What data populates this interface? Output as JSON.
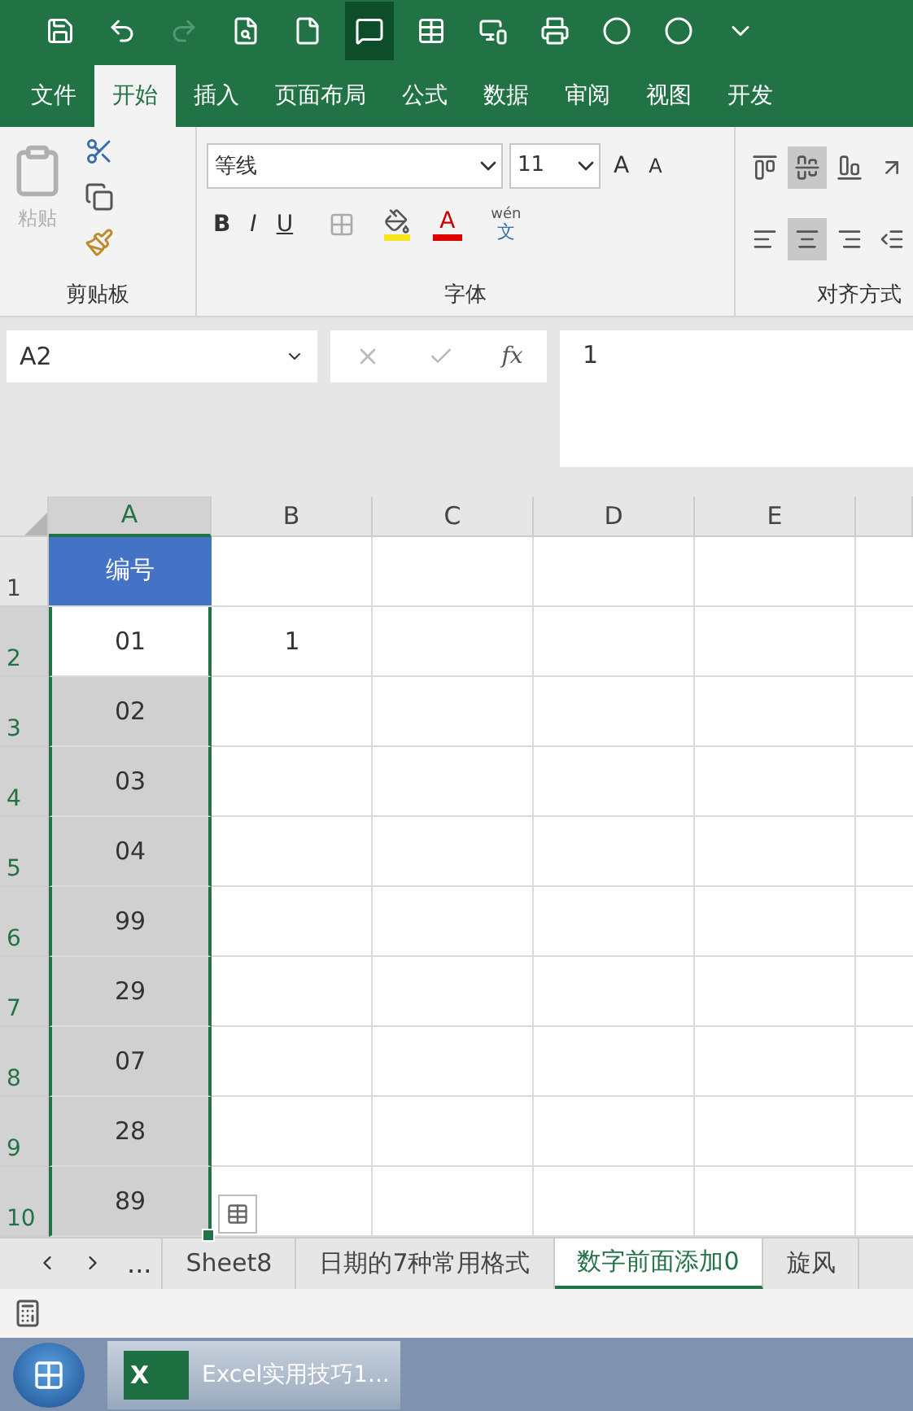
{
  "quick_access": [
    {
      "kind": "save",
      "highlighted": false,
      "disabled": false
    },
    {
      "kind": "undo",
      "highlighted": false,
      "disabled": false
    },
    {
      "kind": "redo",
      "highlighted": false,
      "disabled": true
    },
    {
      "kind": "preview",
      "highlighted": false,
      "disabled": false
    },
    {
      "kind": "new",
      "highlighted": false,
      "disabled": false
    },
    {
      "kind": "comment",
      "highlighted": true,
      "disabled": false
    },
    {
      "kind": "table",
      "highlighted": false,
      "disabled": false
    },
    {
      "kind": "device",
      "highlighted": false,
      "disabled": false
    },
    {
      "kind": "printer",
      "highlighted": false,
      "disabled": false
    },
    {
      "kind": "circle",
      "highlighted": false,
      "disabled": false
    },
    {
      "kind": "circle",
      "highlighted": false,
      "disabled": false
    },
    {
      "kind": "customize",
      "highlighted": false,
      "disabled": false
    }
  ],
  "ribbon_tabs": [
    {
      "label": "文件",
      "selected": false
    },
    {
      "label": "开始",
      "selected": true
    },
    {
      "label": "插入",
      "selected": false
    },
    {
      "label": "页面布局",
      "selected": false
    },
    {
      "label": "公式",
      "selected": false
    },
    {
      "label": "数据",
      "selected": false
    },
    {
      "label": "审阅",
      "selected": false
    },
    {
      "label": "视图",
      "selected": false
    },
    {
      "label": "开发",
      "selected": false
    }
  ],
  "clipboard": {
    "paste_label": "粘贴",
    "group_label": "剪贴板"
  },
  "font": {
    "font_name": "等线",
    "font_size": "11",
    "grow": "A",
    "shrink": "A",
    "styles": [
      "B",
      "I",
      "U"
    ],
    "font_color_label": "A",
    "phonetic_top": "wén",
    "phonetic_bottom": "文",
    "group_label": "字体"
  },
  "alignment": {
    "group_label": "对齐方式",
    "buttons": [
      {
        "kind": "top",
        "selected": false
      },
      {
        "kind": "middle",
        "selected": true
      },
      {
        "kind": "bottom",
        "selected": false
      },
      {
        "kind": "orient",
        "selected": false
      },
      {
        "kind": "left",
        "selected": false
      },
      {
        "kind": "center",
        "selected": true
      },
      {
        "kind": "right",
        "selected": false
      },
      {
        "kind": "indent",
        "selected": false
      }
    ]
  },
  "name_box": "A2",
  "function_label": "fx",
  "formula": "1",
  "columns": [
    {
      "label": "A",
      "selected": true
    },
    {
      "label": "B",
      "selected": false
    },
    {
      "label": "C",
      "selected": false
    },
    {
      "label": "D",
      "selected": false
    },
    {
      "label": "E",
      "selected": false
    }
  ],
  "rows": [
    {
      "number": "1",
      "selected": false,
      "a": {
        "text": "编号",
        "kind": "header",
        "active": false
      }
    },
    {
      "number": "2",
      "selected": true,
      "a": {
        "text": "01",
        "kind": "value",
        "active": true
      },
      "b": "1"
    },
    {
      "number": "3",
      "selected": true,
      "a": {
        "text": "02",
        "kind": "value",
        "active": false
      }
    },
    {
      "number": "4",
      "selected": true,
      "a": {
        "text": "03",
        "kind": "value",
        "active": false
      }
    },
    {
      "number": "5",
      "selected": true,
      "a": {
        "text": "04",
        "kind": "value",
        "active": false
      }
    },
    {
      "number": "6",
      "selected": true,
      "a": {
        "text": "99",
        "kind": "value",
        "active": false
      }
    },
    {
      "number": "7",
      "selected": true,
      "a": {
        "text": "29",
        "kind": "value",
        "active": false
      }
    },
    {
      "number": "8",
      "selected": true,
      "a": {
        "text": "07",
        "kind": "value",
        "active": false
      }
    },
    {
      "number": "9",
      "selected": true,
      "a": {
        "text": "28",
        "kind": "value",
        "active": false
      }
    },
    {
      "number": "10",
      "selected": true,
      "a": {
        "text": "89",
        "kind": "value",
        "active": false
      }
    }
  ],
  "sheet_nav_more": "...",
  "sheet_tabs": [
    {
      "label": "Sheet8",
      "selected": false
    },
    {
      "label": "日期的7种常用格式",
      "selected": false
    },
    {
      "label": "数字前面添加0",
      "selected": true
    },
    {
      "label": "旋风",
      "selected": false
    }
  ],
  "taskbar": {
    "app_icon_letter": "X",
    "app_label": "Excel实用技巧1..."
  }
}
